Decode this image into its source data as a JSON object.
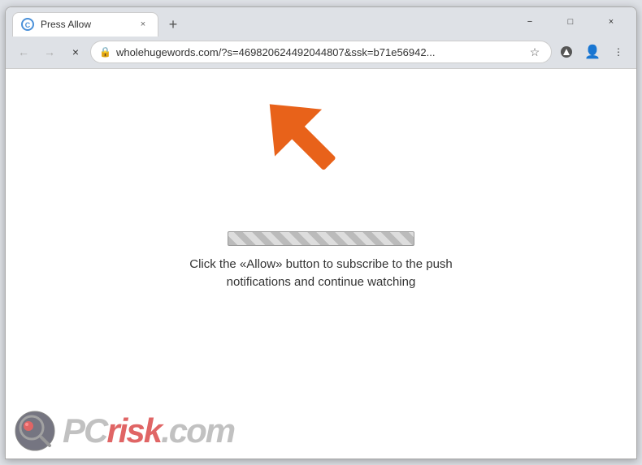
{
  "window": {
    "title": "Press Allow",
    "tab": {
      "favicon": "C",
      "title": "Press Allow",
      "close_label": "×"
    },
    "new_tab_label": "+",
    "controls": {
      "minimize": "−",
      "maximize": "□",
      "close": "×"
    }
  },
  "toolbar": {
    "back_label": "←",
    "forward_label": "→",
    "reload_label": "×",
    "url": "wholehugewords.com/?s=469820624492044807&ssk=b71e56942...",
    "lock_icon": "🔒",
    "star_label": "☆",
    "extensions_label": "⬇",
    "profile_label": "👤",
    "menu_label": "⋮"
  },
  "page": {
    "message": "Click the «Allow» button to subscribe to the push notifications and continue watching",
    "progress_aria": "loading progress"
  },
  "watermark": {
    "text_gray": "PC",
    "text_red": "risk",
    "text_suffix": ".com"
  }
}
